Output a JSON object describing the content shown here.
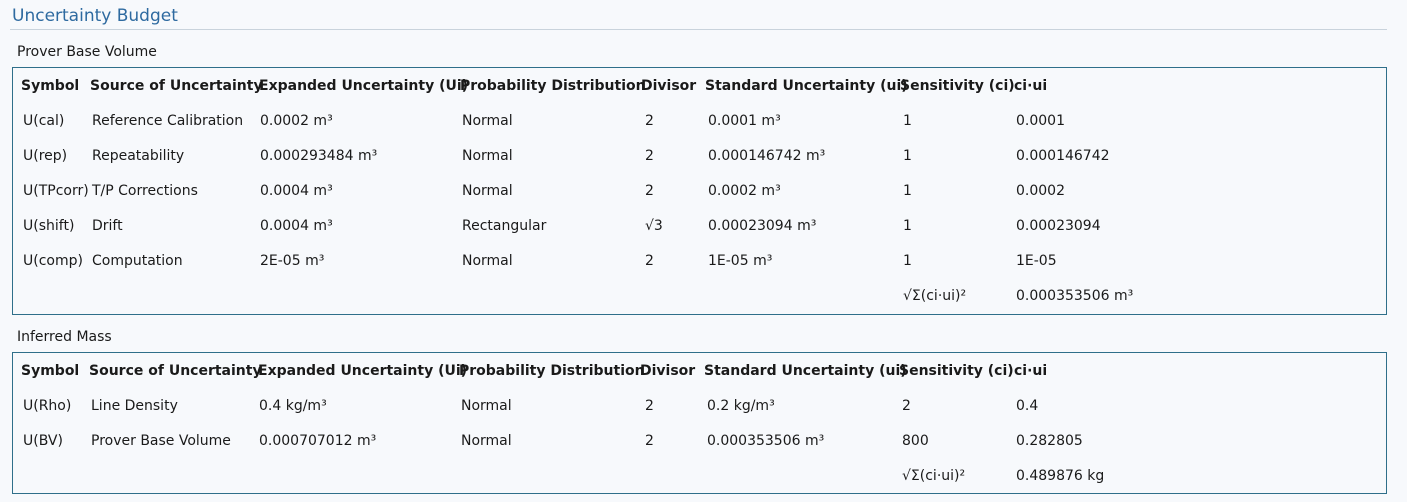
{
  "page": {
    "title": "Uncertainty Budget"
  },
  "columns": [
    "Symbol",
    "Source of Uncertainty",
    "Expanded Uncertainty (Ui)",
    "Probability Distribution",
    "Divisor",
    "Standard Uncertainty (ui)",
    "Sensitivity (ci)",
    "ci·ui"
  ],
  "sections": [
    {
      "label": "Prover Base Volume",
      "rows": [
        [
          "U(cal)",
          "Reference Calibration",
          "0.0002 m³",
          "Normal",
          "2",
          "0.0001 m³",
          "1",
          "0.0001"
        ],
        [
          "U(rep)",
          "Repeatability",
          "0.000293484 m³",
          "Normal",
          "2",
          "0.000146742 m³",
          "1",
          "0.000146742"
        ],
        [
          "U(TPcorr)",
          "T/P Corrections",
          "0.0004 m³",
          "Normal",
          "2",
          "0.0002 m³",
          "1",
          "0.0002"
        ],
        [
          "U(shift)",
          "Drift",
          "0.0004 m³",
          "Rectangular",
          "√3",
          "0.00023094 m³",
          "1",
          "0.00023094"
        ],
        [
          "U(comp)",
          "Computation",
          "2E-05 m³",
          "Normal",
          "2",
          "1E-05 m³",
          "1",
          "1E-05"
        ]
      ],
      "total_label": "√Σ(ci·ui)²",
      "total_value": "0.000353506 m³"
    },
    {
      "label": "Inferred Mass",
      "rows": [
        [
          "U(Rho)",
          "Line Density",
          "0.4 kg/m³",
          "Normal",
          "2",
          "0.2 kg/m³",
          "2",
          "0.4"
        ],
        [
          "U(BV)",
          "Prover Base Volume",
          "0.000707012 m³",
          "Normal",
          "2",
          "0.000353506 m³",
          "800",
          "0.282805"
        ]
      ],
      "total_label": "√Σ(ci·ui)²",
      "total_value": "0.489876 kg"
    }
  ],
  "colors": {
    "title": "#2e6aa0",
    "panel_border": "#2f6f8a",
    "background": "#f7f9fc"
  }
}
